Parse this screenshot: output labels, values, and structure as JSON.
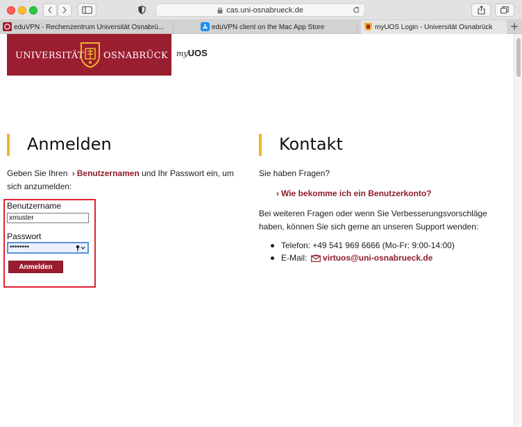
{
  "browser": {
    "url": "cas.uni-osnabrueck.de",
    "tabs": [
      {
        "label": "eduVPN - Rechenzentrum Universität Osnabrü..."
      },
      {
        "label": "eduVPN client on the Mac App Store"
      },
      {
        "label": "myUOS Login - Universität Osnabrück"
      }
    ],
    "new_tab_label": "+"
  },
  "header": {
    "logo_left": "UNIVERSITÄT",
    "logo_right": "OSNABRÜCK",
    "myuos_my": "my",
    "myuos_uos": "UOS"
  },
  "login": {
    "title": "Anmelden",
    "intro_before": "Geben Sie Ihren",
    "intro_link": "Benutzernamen",
    "intro_after_line1": "und Ihr Passwort ein, um",
    "intro_line2": "sich anzumelden:",
    "username_label": "Benutzername",
    "username_value": "xmuster",
    "password_label": "Passwort",
    "password_value": "••••••••",
    "submit_label": "Anmelden"
  },
  "contact": {
    "title": "Kontakt",
    "question": "Sie haben Fragen?",
    "faq_link": "Wie bekomme ich ein Benutzerkonto?",
    "info_line1": "Bei weiteren Fragen oder wenn Sie Verbesserungsvorschläge",
    "info_line2": "haben, können Sie sich gerne an unseren Support wenden:",
    "phone": "Telefon: +49 541 969 6666 (Mo-Fr: 9:00-14:00)",
    "email_label": "E-Mail:",
    "email": "virtuos@uni-osnabrueck.de"
  },
  "colors": {
    "brand": "#9b1d30",
    "accent_bar": "#f0b429",
    "link": "#8c1c2a",
    "highlight_box": "#e0202e"
  },
  "icons": [
    "back-icon",
    "forward-icon",
    "sidebar-icon",
    "shield-icon",
    "lock-icon",
    "reload-icon",
    "share-icon",
    "tabs-overview-icon",
    "chevron-down-icon",
    "key-icon",
    "mail-icon"
  ]
}
